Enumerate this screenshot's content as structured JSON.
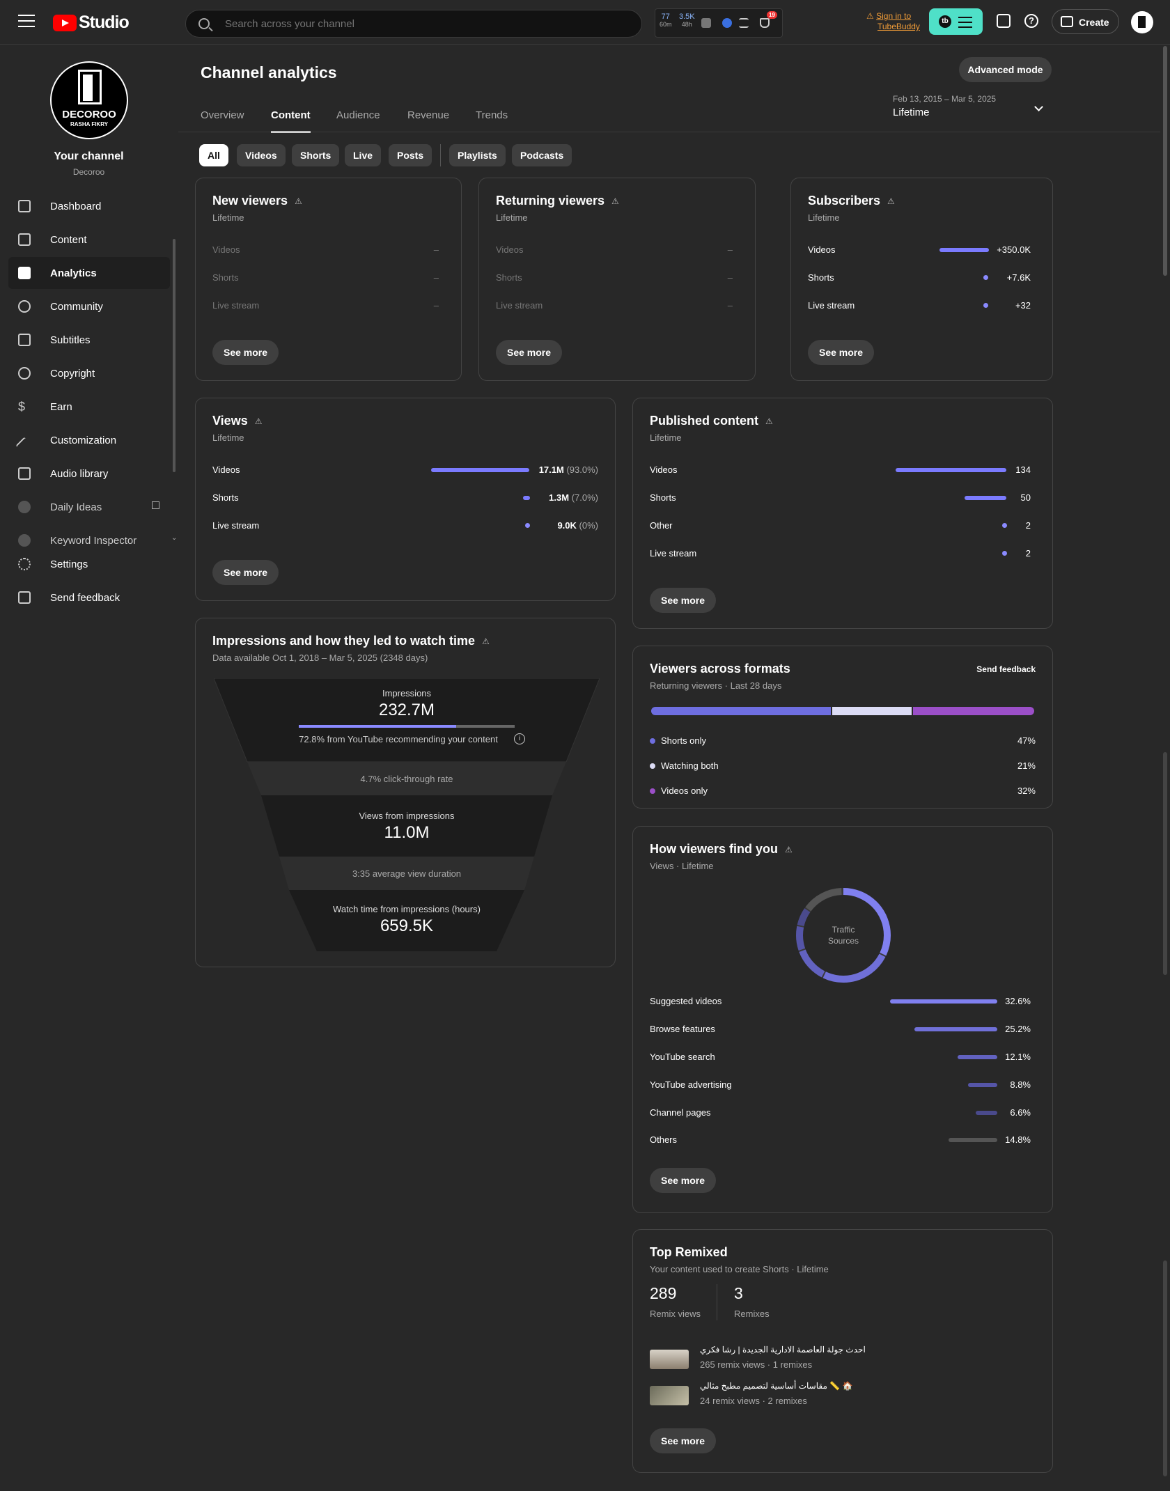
{
  "app": {
    "logo_text": "Studio",
    "search_placeholder": "Search across your channel"
  },
  "toolbar": {
    "tb_stats": [
      {
        "value": "77",
        "sub": "60m"
      },
      {
        "value": "3.5K",
        "sub": "48h"
      }
    ],
    "notif_count": "19",
    "signin_line1": "Sign in to",
    "signin_line2": "TubeBuddy",
    "tube_logo": "tb",
    "create_label": "Create"
  },
  "sidebar": {
    "avatar_title": "DECOROO",
    "avatar_sub": "RASHA FIKRY",
    "your_channel": "Your channel",
    "channel_name": "Decoroo",
    "items": [
      {
        "label": "Dashboard",
        "icon": "dashboard-icon"
      },
      {
        "label": "Content",
        "icon": "content-icon"
      },
      {
        "label": "Analytics",
        "icon": "analytics-icon",
        "active": true
      },
      {
        "label": "Community",
        "icon": "community-icon"
      },
      {
        "label": "Subtitles",
        "icon": "subtitles-icon"
      },
      {
        "label": "Copyright",
        "icon": "copyright-icon"
      },
      {
        "label": "Earn",
        "icon": "earn-icon"
      },
      {
        "label": "Customization",
        "icon": "customization-icon"
      },
      {
        "label": "Audio library",
        "icon": "audio-library-icon"
      },
      {
        "label": "Daily Ideas",
        "icon": "daily-ideas-icon"
      },
      {
        "label": "Keyword Inspector",
        "icon": "keyword-inspector-icon"
      },
      {
        "label": "Settings",
        "icon": "settings-icon"
      },
      {
        "label": "Send feedback",
        "icon": "feedback-icon"
      }
    ]
  },
  "page": {
    "title": "Channel analytics",
    "advanced_mode": "Advanced mode",
    "tabs": [
      "Overview",
      "Content",
      "Audience",
      "Revenue",
      "Trends"
    ],
    "active_tab": "Content",
    "date_range": "Feb 13, 2015 – Mar 5, 2025",
    "date_label": "Lifetime",
    "chips": [
      "All",
      "Videos",
      "Shorts",
      "Live",
      "Posts",
      "Playlists",
      "Podcasts"
    ],
    "active_chip": "All"
  },
  "cards": {
    "see_more": "See more",
    "new_viewers": {
      "title": "New viewers",
      "sub": "Lifetime",
      "rows": [
        {
          "label": "Videos",
          "value": "–"
        },
        {
          "label": "Shorts",
          "value": "–"
        },
        {
          "label": "Live stream",
          "value": "–"
        }
      ]
    },
    "returning_viewers": {
      "title": "Returning viewers",
      "sub": "Lifetime",
      "rows": [
        {
          "label": "Videos",
          "value": "–"
        },
        {
          "label": "Shorts",
          "value": "–"
        },
        {
          "label": "Live stream",
          "value": "–"
        }
      ]
    },
    "subscribers": {
      "title": "Subscribers",
      "sub": "Lifetime",
      "rows": [
        {
          "label": "Videos",
          "value": "+350.0K",
          "share": 0.977
        },
        {
          "label": "Shorts",
          "value": "+7.6K",
          "share": 0.021
        },
        {
          "label": "Live stream",
          "value": "+32",
          "share": 0.0001
        }
      ]
    },
    "views": {
      "title": "Views",
      "sub": "Lifetime",
      "rows": [
        {
          "label": "Videos",
          "value": "17.1M",
          "pct": "(93.0%)",
          "share": 0.93
        },
        {
          "label": "Shorts",
          "value": "1.3M",
          "pct": "(7.0%)",
          "share": 0.07
        },
        {
          "label": "Live stream",
          "value": "9.0K",
          "pct": "(0%)",
          "share": 0.0
        }
      ]
    },
    "published": {
      "title": "Published content",
      "sub": "Lifetime",
      "rows": [
        {
          "label": "Videos",
          "value": "134",
          "share": 1.0
        },
        {
          "label": "Shorts",
          "value": "50",
          "share": 0.373
        },
        {
          "label": "Other",
          "value": "2",
          "share": 0.015
        },
        {
          "label": "Live stream",
          "value": "2",
          "share": 0.015
        }
      ]
    },
    "impressions": {
      "title": "Impressions and how they led to watch time",
      "sub": "Data available Oct 1, 2018 – Mar 5, 2025 (2348 days)",
      "imp_label": "Impressions",
      "imp_value": "232.7M",
      "imp_note": "72.8% from YouTube recommending your content",
      "imp_share": 0.728,
      "ctr": "4.7% click-through rate",
      "views_label": "Views from impressions",
      "views_value": "11.0M",
      "avd": "3:35 average view duration",
      "wt_label": "Watch time from impressions (hours)",
      "wt_value": "659.5K"
    },
    "formats": {
      "title": "Viewers across formats",
      "sub": "Returning viewers · Last 28 days",
      "send_feedback": "Send feedback",
      "items": [
        {
          "label": "Shorts only",
          "value": "47%",
          "share": 0.47,
          "color": "#6e6ee0"
        },
        {
          "label": "Watching both",
          "value": "21%",
          "share": 0.21,
          "color": "#dcdcf5"
        },
        {
          "label": "Videos only",
          "value": "32%",
          "share": 0.32,
          "color": "#9b4fc8"
        }
      ]
    },
    "find": {
      "title": "How viewers find you",
      "sub": "Views · Lifetime",
      "donut_label_1": "Traffic",
      "donut_label_2": "Sources",
      "items": [
        {
          "label": "Suggested videos",
          "value": "32.6%",
          "share": 0.326,
          "color": "#8080f0"
        },
        {
          "label": "Browse features",
          "value": "25.2%",
          "share": 0.252,
          "color": "#7070d8"
        },
        {
          "label": "YouTube search",
          "value": "12.1%",
          "share": 0.121,
          "color": "#6262c0"
        },
        {
          "label": "YouTube advertising",
          "value": "8.8%",
          "share": 0.088,
          "color": "#5555a8"
        },
        {
          "label": "Channel pages",
          "value": "6.6%",
          "share": 0.066,
          "color": "#4a4a8c"
        },
        {
          "label": "Others",
          "value": "14.8%",
          "share": 0.148,
          "color": "#555555"
        }
      ]
    },
    "remixed": {
      "title": "Top Remixed",
      "sub": "Your content used to create Shorts · Lifetime",
      "stat1_value": "289",
      "stat1_label": "Remix views",
      "stat2_value": "3",
      "stat2_label": "Remixes",
      "items": [
        {
          "title": "احدث جولة العاصمة الادارية الجديدة | رشا فكري",
          "meta": "265 remix views · 1 remixes"
        },
        {
          "title": "مقاسات أساسية لتصميم مطبخ مثالي 📏 🏠",
          "meta": "24 remix views · 2 remixes"
        }
      ]
    }
  }
}
